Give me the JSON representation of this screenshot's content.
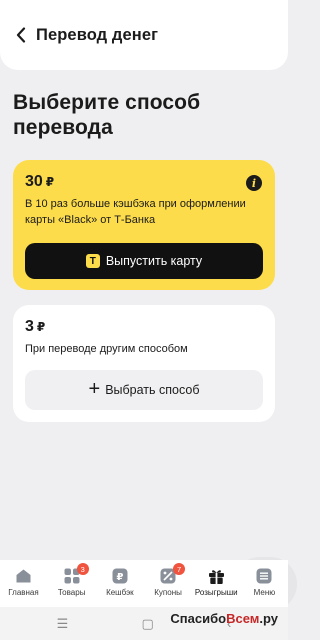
{
  "header": {
    "title": "Перевод денег",
    "back_icon": "chevron-left-icon"
  },
  "page": {
    "title": "Выберите способ перевода"
  },
  "offer_card": {
    "amount": "30",
    "currency": "₽",
    "description": "В 10 раз больше кэшбэка при оформлении карты «Black» от Т-Банка",
    "button_label": "Выпустить карту",
    "button_icon_glyph": "Т",
    "background": "#fddc4b"
  },
  "other_card": {
    "amount": "3",
    "currency": "₽",
    "description": "При переводе другим способом",
    "button_label": "Выбрать способ"
  },
  "tabbar": {
    "tabs": [
      {
        "label": "Главная",
        "icon": "home-icon",
        "badge": null
      },
      {
        "label": "Товары",
        "icon": "grid-icon",
        "badge": "3"
      },
      {
        "label": "Кешбэк",
        "icon": "ruble-icon",
        "badge": null
      },
      {
        "label": "Купоны",
        "icon": "coupon-icon",
        "badge": "7"
      },
      {
        "label": "Розыгрыши",
        "icon": "gift-icon",
        "badge": null
      },
      {
        "label": "Меню",
        "icon": "menu-icon",
        "badge": null
      }
    ]
  },
  "watermark": {
    "part1": "Спасибо",
    "part2": "Всем",
    "part3": ".ру"
  },
  "colors": {
    "accent_yellow": "#fddc4b",
    "badge_red": "#f0533e",
    "button_black": "#111111"
  }
}
